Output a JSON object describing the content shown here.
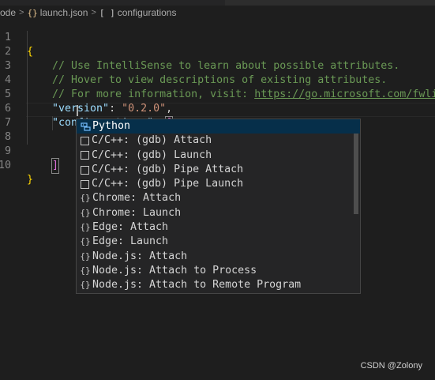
{
  "breadcrumb": {
    "items": [
      "ode",
      "launch.json",
      "configurations"
    ],
    "braces_glyph": "{}",
    "brackets_glyph": "[ ]",
    "separator": ">"
  },
  "editor": {
    "line_numbers": [
      "1",
      "2",
      "3",
      "4",
      "5",
      "6",
      "7",
      "8",
      "9",
      "10"
    ],
    "lines": {
      "l1": "{",
      "l2": "// Use IntelliSense to learn about possible attributes.",
      "l3": "// Hover to view descriptions of existing attributes.",
      "l4_text": "// For more information, visit: ",
      "l4_link": "https://go.microsoft.com/fwli",
      "l5_key": "\"version\"",
      "l5_colon": ": ",
      "l5_value": "\"0.2.0\"",
      "l5_comma": ",",
      "l6_key": "\"configurations\"",
      "l6_colon": ": ",
      "l6_bracket": "[",
      "l9_bracket": "]",
      "l10": "}"
    }
  },
  "suggest_widget": {
    "items": [
      {
        "label": "Python",
        "icon": "python-icon",
        "selected": true
      },
      {
        "label": "C/C++: (gdb) Attach",
        "icon": "box-icon"
      },
      {
        "label": "C/C++: (gdb) Launch",
        "icon": "box-icon"
      },
      {
        "label": "C/C++: (gdb) Pipe Attach",
        "icon": "box-icon"
      },
      {
        "label": "C/C++: (gdb) Pipe Launch",
        "icon": "box-icon"
      },
      {
        "label": "Chrome: Attach",
        "icon": "braces-icon"
      },
      {
        "label": "Chrome: Launch",
        "icon": "braces-icon"
      },
      {
        "label": "Edge: Attach",
        "icon": "braces-icon"
      },
      {
        "label": "Edge: Launch",
        "icon": "braces-icon"
      },
      {
        "label": "Node.js: Attach",
        "icon": "braces-icon"
      },
      {
        "label": "Node.js: Attach to Process",
        "icon": "braces-icon"
      },
      {
        "label": "Node.js: Attach to Remote Program",
        "icon": "braces-icon"
      }
    ],
    "braces_glyph": "{}"
  },
  "watermark": "CSDN @Zolony",
  "colors": {
    "background": "#1e1e1e",
    "comment": "#6a9955",
    "json_key": "#9cdcfe",
    "string": "#ce9178",
    "brace": "#ffd700",
    "selection": "#062f4a"
  }
}
